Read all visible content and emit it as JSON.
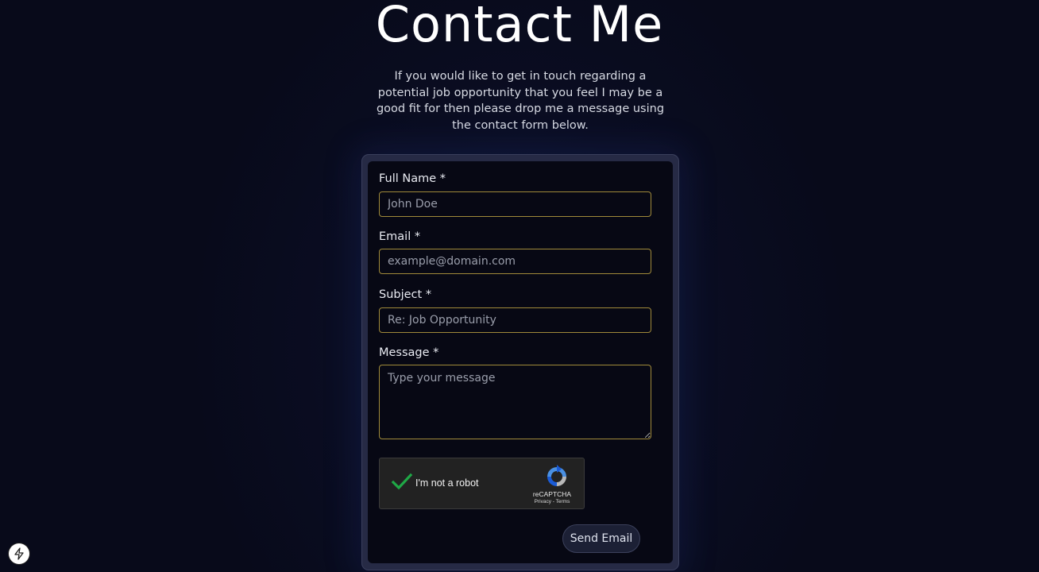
{
  "header": {
    "title": "Contact Me",
    "subtitle": "If you would like to get in touch regarding a potential job opportunity that you feel I may be a good fit for then please drop me a message using the contact form below."
  },
  "form": {
    "full_name": {
      "label": "Full Name *",
      "placeholder": "John Doe"
    },
    "email": {
      "label": "Email *",
      "placeholder": "example@domain.com"
    },
    "subject": {
      "label": "Subject *",
      "placeholder": "Re: Job Opportunity"
    },
    "message": {
      "label": "Message *",
      "placeholder": "Type your message"
    },
    "recaptcha": {
      "label": "I'm not a robot",
      "brand": "reCAPTCHA",
      "privacy": "Privacy",
      "separator": "-",
      "terms": "Terms",
      "checked": true
    },
    "submit_label": "Send Email"
  },
  "dev_badge": {
    "icon": "lightning-icon"
  },
  "colors": {
    "background": "#080a1a",
    "card_border": "#262a45",
    "field_border": "#a08a3a",
    "check_green": "#1fa846"
  }
}
